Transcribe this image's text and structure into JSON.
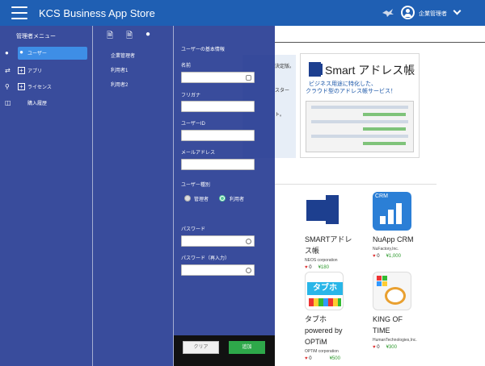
{
  "header": {
    "title": "KCS Business App Store",
    "user_name": "企業管理者"
  },
  "banner": {
    "left_text": "決定版。",
    "left_text2": "スタート。",
    "smart_title": "Smart アドレス帳",
    "smart_sub1": "ビジネス用途に特化した、",
    "smart_sub2": "クラウド型のアドレス帳サービス！"
  },
  "apps": [
    {
      "name_line1": "SMARTアドレ",
      "name_line2": "ス帳",
      "vendor": "NEOS corporation",
      "likes": "0",
      "price": "¥180"
    },
    {
      "name_line1": "NuApp CRM",
      "name_line2": "",
      "vendor": "NuFactory,Inc.",
      "likes": "0",
      "price": "¥1,000"
    },
    {
      "name_line1": "タブホ",
      "name_line2": "powered by",
      "name_line3": "OPTiM",
      "vendor": "OPTiM corporation",
      "likes": "0",
      "price": "¥500",
      "icon_text": "タブホ"
    },
    {
      "name_line1": "KING OF",
      "name_line2": "TIME",
      "vendor": "HumanTechnologies,Inc.",
      "likes": "0",
      "price": "¥300"
    }
  ],
  "nuapp_icon_label": "CRM",
  "sidebar": {
    "heading": "管理者メニュー",
    "items": [
      {
        "label": "ユーザー",
        "icon": "user-icon",
        "active": true
      },
      {
        "label": "アプリ",
        "icon": "app-icon"
      },
      {
        "label": "ライセンス",
        "icon": "key-icon"
      },
      {
        "label": "購入履歴",
        "icon": "book-icon"
      }
    ]
  },
  "subpanel": {
    "items": [
      "企業管理者",
      "利用者1",
      "利用者2"
    ]
  },
  "form": {
    "heading": "ユーザーの基本情報",
    "name_label": "名前",
    "kana_label": "フリガナ",
    "userid_label": "ユーザーID",
    "email_label": "メールアドレス",
    "usertype_label": "ユーザー種別",
    "type_admin": "管理者",
    "type_user": "利用者",
    "password_label": "パスワード",
    "password_confirm_label": "パスワード（再入力）",
    "clear_button": "クリア",
    "add_button": "追加"
  },
  "colors": {
    "header": "#1f5fb3",
    "overlay": "#182e8c",
    "active": "#3e8ee6",
    "add_button": "#2ea84a",
    "price": "#2e9a2e",
    "heart": "#dd3333"
  }
}
